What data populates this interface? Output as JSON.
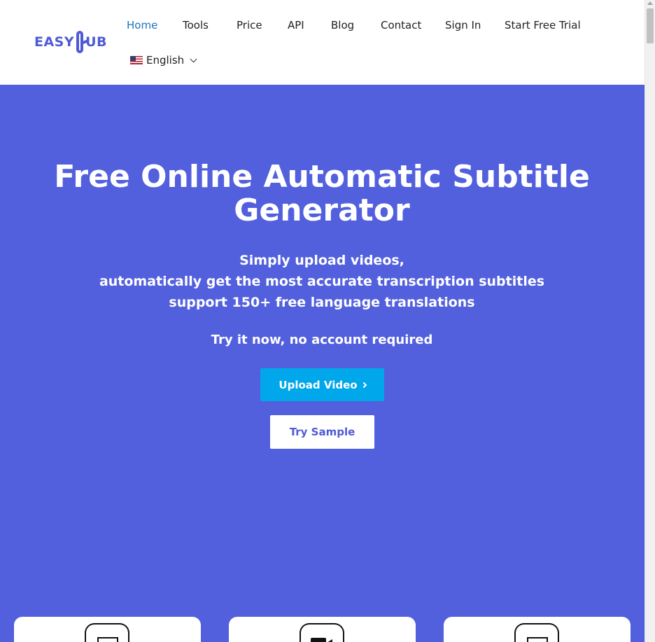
{
  "brand": {
    "logo_text_left": "EASY",
    "logo_text_right": "UB",
    "accent_color": "#5260dd"
  },
  "nav": {
    "items": [
      {
        "label": "Home",
        "active": true
      },
      {
        "label": "Tools",
        "active": false
      },
      {
        "label": "Price",
        "active": false
      },
      {
        "label": "API",
        "active": false
      },
      {
        "label": "Blog",
        "active": false
      },
      {
        "label": "Contact",
        "active": false
      },
      {
        "label": "Sign In",
        "active": false
      },
      {
        "label": "Start Free Trial",
        "active": false
      }
    ],
    "language": {
      "label": "English",
      "flag_icon": "us-flag-icon",
      "dropdown_icon": "chevron-down-icon"
    }
  },
  "hero": {
    "title_line1": "Free Online Automatic Subtitle",
    "title_line2": "Generator",
    "subtitle_lines": [
      "Simply upload videos,",
      "automatically get the most accurate transcription subtitles",
      "support 150+ free language translations"
    ],
    "try_text": "Try it now, no account required",
    "upload_button": "Upload Video",
    "sample_button": "Try Sample",
    "background_color": "#5260dd",
    "upload_button_color": "#00a7eb"
  },
  "feature_cards": [
    {
      "icon": "screen-icon"
    },
    {
      "icon": "video-camera-icon"
    },
    {
      "icon": "document-icon"
    }
  ]
}
